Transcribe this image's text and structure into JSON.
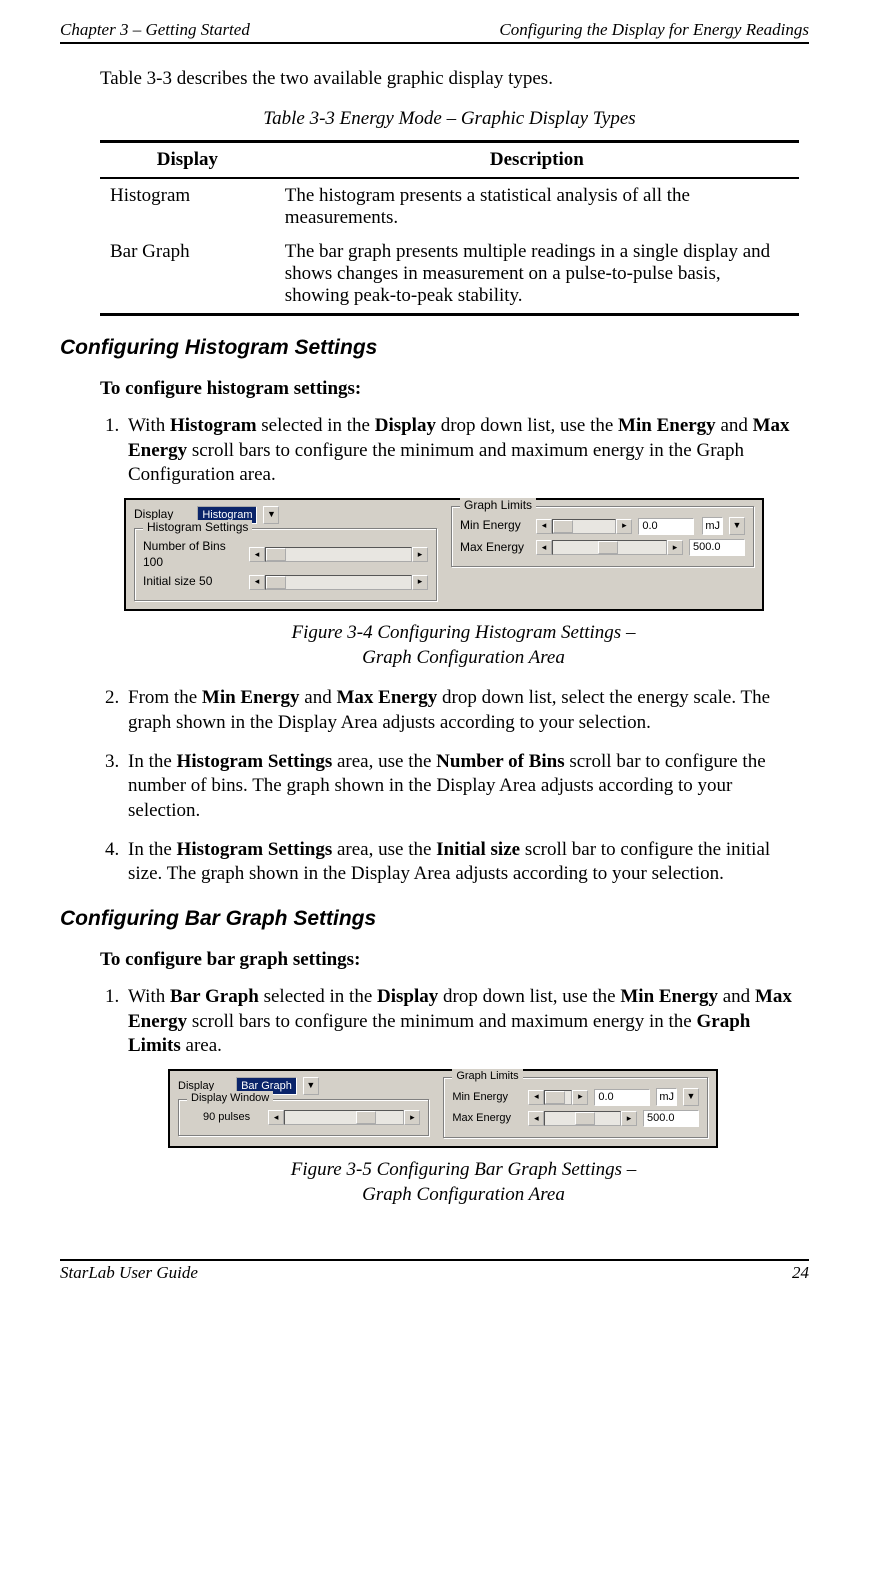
{
  "header": {
    "left": "Chapter 3 – Getting Started",
    "right": "Configuring the Display for Energy Readings"
  },
  "intro": {
    "pre": "Table 3-3",
    "post": " describes the two available graphic display types."
  },
  "table": {
    "caption": "Table 3-3 Energy Mode – Graphic Display Types",
    "cols": [
      "Display",
      "Description"
    ],
    "rows": [
      {
        "c0": "Histogram",
        "c1": "The histogram presents a statistical analysis of all the measurements."
      },
      {
        "c0": "Bar Graph",
        "c1": "The bar graph presents multiple readings in a single display and shows changes in measurement on a pulse-to-pulse basis, showing peak-to-peak stability."
      }
    ]
  },
  "hist": {
    "heading": "Configuring Histogram Settings",
    "sub": "To configure histogram settings:",
    "steps": {
      "s1": {
        "a": "With ",
        "b1": "Histogram",
        "c": " selected in the ",
        "b2": "Display",
        "d": " drop down list, use the ",
        "b3": "Min Energy",
        "e": " and ",
        "b4": "Max Energy",
        "f": " scroll bars to configure the minimum and maximum energy in the Graph Configuration area."
      },
      "s2": {
        "a": "From the ",
        "b1": "Min Energy",
        "c": " and ",
        "b2": "Max Energy",
        "d": " drop down list, select the energy scale. The graph shown in the Display Area adjusts according to your selection."
      },
      "s3": {
        "a": "In the ",
        "b1": "Histogram Settings",
        "c": " area, use the ",
        "b2": "Number of Bins",
        "d": " scroll bar to configure the number of bins. The graph shown in the Display Area adjusts according to your selection."
      },
      "s4": {
        "a": "In the ",
        "b1": "Histogram Settings",
        "c": " area, use the ",
        "b2": "Initial size",
        "d": " scroll bar to configure the initial size. The graph shown in the Display Area adjusts according to your selection."
      }
    }
  },
  "bar": {
    "heading": "Configuring Bar Graph Settings",
    "sub": "To configure bar graph settings:",
    "steps": {
      "s1": {
        "a": "With ",
        "b1": "Bar Graph",
        "c": " selected in the ",
        "b2": "Display",
        "d": " drop down list, use the ",
        "b3": "Min Energy",
        "e": " and ",
        "b4": "Max Energy",
        "f": " scroll bars to configure the minimum and maximum energy in the ",
        "b5": "Graph Limits",
        "g": " area."
      }
    }
  },
  "fig34": {
    "caption1": "Figure 3-4 Configuring Histogram Settings –",
    "caption2": "Graph Configuration Area",
    "display_label": "Display",
    "display_value": "Histogram",
    "fs_left": "Histogram Settings",
    "bins_label": "Number of Bins 100",
    "init_label": "Initial size 50",
    "fs_right": "Graph Limits",
    "min_label": "Min Energy",
    "min_val": "0.0",
    "max_label": "Max Energy",
    "max_val": "500.0",
    "unit": "mJ"
  },
  "fig35": {
    "caption1": "Figure 3-5 Configuring Bar Graph Settings –",
    "caption2": "Graph Configuration Area",
    "display_label": "Display",
    "display_value": "Bar Graph",
    "fs_left": "Display Window",
    "pulses_label": "90 pulses",
    "fs_right": "Graph Limits",
    "min_label": "Min Energy",
    "min_val": "0.0",
    "max_label": "Max Energy",
    "max_val": "500.0",
    "unit": "mJ"
  },
  "footer": {
    "left": "StarLab User Guide",
    "right": "24"
  }
}
